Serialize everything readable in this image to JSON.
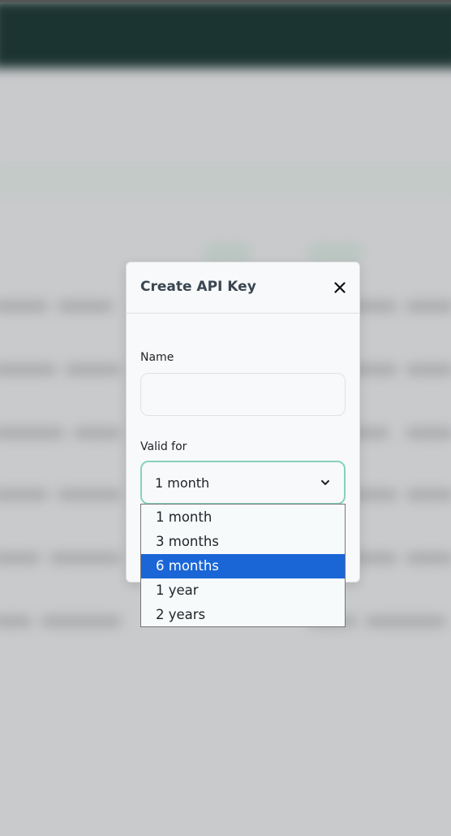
{
  "modal": {
    "title": "Create API Key",
    "close_icon": "close-icon",
    "name_label": "Name",
    "name_value": "",
    "name_placeholder": "",
    "valid_label": "Valid for",
    "valid_selected": "1 month",
    "chevron_icon": "chevron-down-icon"
  },
  "dropdown": {
    "options": [
      "1 month",
      "3 months",
      "6 months",
      "1 year",
      "2 years"
    ],
    "highlighted": "6 months",
    "highlight_color": "#1a66d6"
  },
  "colors": {
    "header": "#1c3431",
    "focus_border": "#86d3b9",
    "overlay": "#c9cacc"
  }
}
